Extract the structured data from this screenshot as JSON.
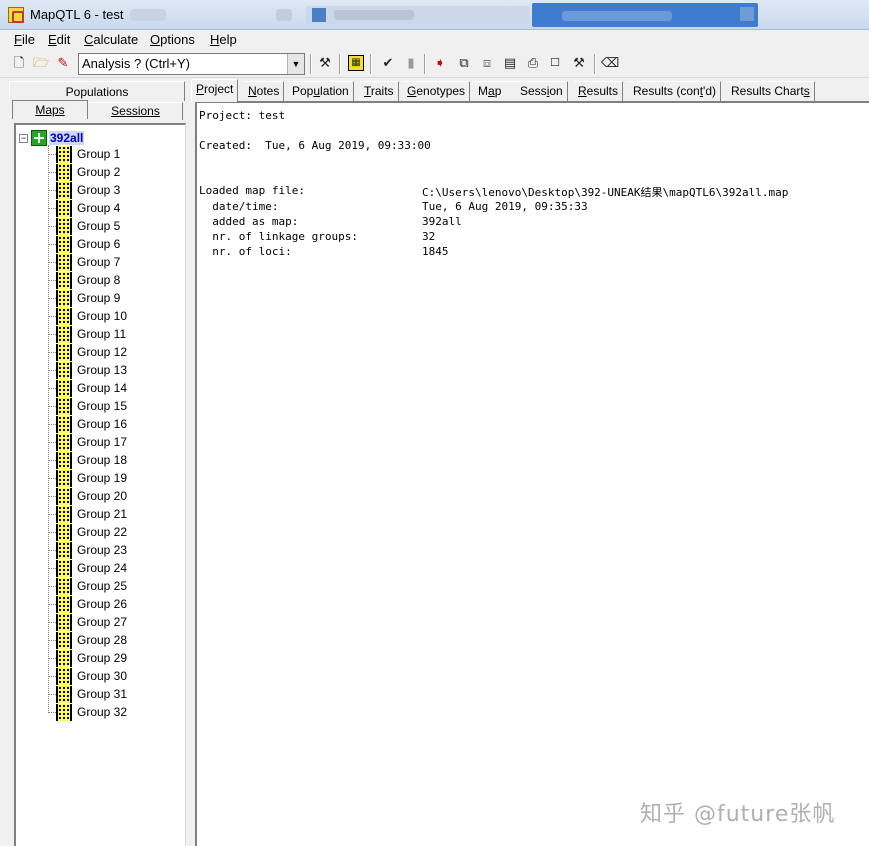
{
  "window": {
    "title": "MapQTL 6 - test"
  },
  "menu": [
    {
      "accel": "F",
      "rest": "ile"
    },
    {
      "accel": "E",
      "rest": "dit"
    },
    {
      "accel": "C",
      "rest": "alculate"
    },
    {
      "accel": "O",
      "rest": "ptions"
    },
    {
      "accel": "H",
      "rest": "elp"
    }
  ],
  "toolbar": {
    "analysis_value": "Analysis ? (Ctrl+Y)"
  },
  "left_tabs": {
    "populations": "Populations",
    "maps": "Maps",
    "sessions": "Sessions"
  },
  "tree": {
    "root": "392all",
    "groups": [
      "Group 1",
      "Group 2",
      "Group 3",
      "Group 4",
      "Group 5",
      "Group 6",
      "Group 7",
      "Group 8",
      "Group 9",
      "Group 10",
      "Group 11",
      "Group 12",
      "Group 13",
      "Group 14",
      "Group 15",
      "Group 16",
      "Group 17",
      "Group 18",
      "Group 19",
      "Group 20",
      "Group 21",
      "Group 22",
      "Group 23",
      "Group 24",
      "Group 25",
      "Group 26",
      "Group 27",
      "Group 28",
      "Group 29",
      "Group 30",
      "Group 31",
      "Group 32"
    ]
  },
  "tabs": [
    {
      "accel": "P",
      "rest": "roject",
      "active": true
    },
    {
      "accel": "N",
      "rest": "otes"
    },
    {
      "pre": "Pop",
      "accel": "u",
      "rest": "lation"
    },
    {
      "accel": "T",
      "rest": "raits"
    },
    {
      "accel": "G",
      "rest": "enotypes"
    },
    {
      "pre": "M",
      "accel": "a",
      "rest": "p"
    },
    {
      "pre": "Sess",
      "accel": "i",
      "rest": "on"
    },
    {
      "accel": "R",
      "rest": "esults"
    },
    {
      "pre": "Results (con",
      "accel": "t",
      "rest": "'d)"
    },
    {
      "pre": "Results Chart",
      "accel": "s",
      "rest": ""
    }
  ],
  "content": {
    "project_line": "Project: test",
    "created_line": "Created:  Tue, 6 Aug 2019, 09:33:00",
    "loaded_label": "Loaded map file:",
    "loaded_value": "C:\\Users\\lenovo\\Desktop\\392-UNEAK结果\\mapQTL6\\392all.map",
    "datetime_label": "  date/time:",
    "datetime_value": "Tue, 6 Aug 2019, 09:35:33",
    "added_label": "  added as map:",
    "added_value": "392all",
    "groups_label": "  nr. of linkage groups:",
    "groups_value": "32",
    "loci_label": "  nr. of loci:",
    "loci_value": "1845"
  },
  "watermark": "知乎 @future张帆"
}
